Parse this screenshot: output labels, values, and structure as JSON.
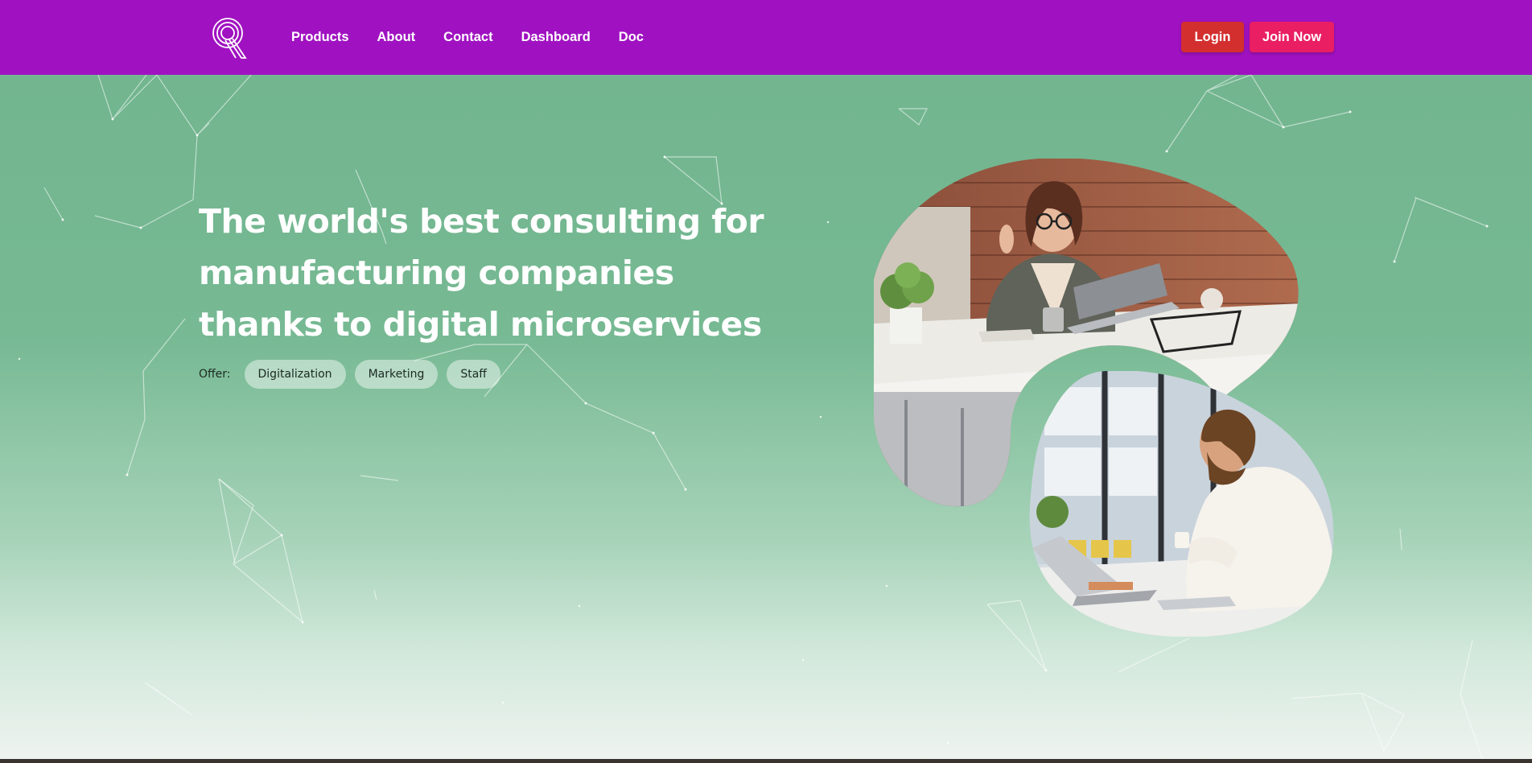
{
  "nav": {
    "logo": "Q",
    "links": [
      "Products",
      "About",
      "Contact",
      "Dashboard",
      "Doc"
    ],
    "login_label": "Login",
    "join_label": "Join Now"
  },
  "hero": {
    "headline_lines": [
      "The world's best consulting for",
      "manufacturing companies",
      "thanks to digital microservices"
    ],
    "offer_label": "Offer:",
    "chips": [
      "Digitalization",
      "Marketing",
      "Staff"
    ]
  },
  "colors": {
    "navbar": "#a012c1",
    "login": "#d32f2f",
    "join": "#e91e63",
    "hero_top": "#72b58f",
    "hero_bottom": "#eef3ef"
  },
  "images": {
    "top": "woman at desk waving with laptop",
    "bottom": "man at desk with laptop and cup"
  }
}
